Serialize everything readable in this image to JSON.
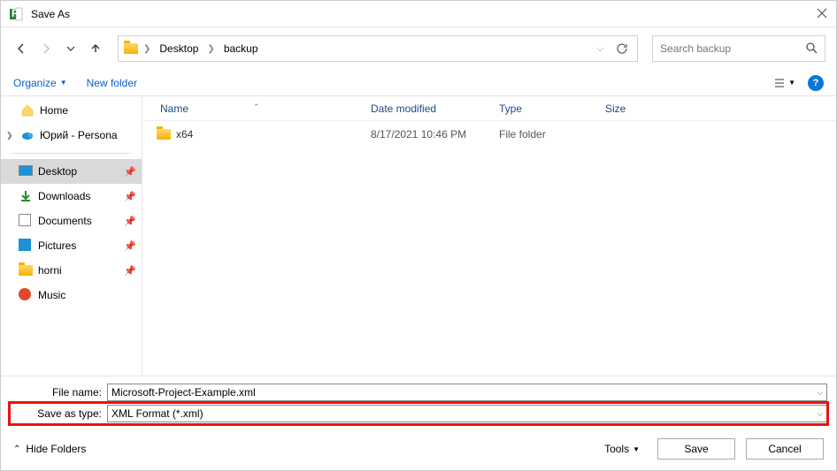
{
  "window": {
    "title": "Save As"
  },
  "breadcrumbs": [
    "Desktop",
    "backup"
  ],
  "search": {
    "placeholder": "Search backup"
  },
  "toolbar": {
    "organize": "Organize",
    "new_folder": "New folder"
  },
  "sidebar": {
    "top": [
      {
        "label": "Home"
      },
      {
        "label": "Юрий - Persona"
      }
    ],
    "quick": [
      {
        "label": "Desktop"
      },
      {
        "label": "Downloads"
      },
      {
        "label": "Documents"
      },
      {
        "label": "Pictures"
      },
      {
        "label": "horni"
      },
      {
        "label": "Music"
      }
    ]
  },
  "columns": {
    "name": "Name",
    "date": "Date modified",
    "type": "Type",
    "size": "Size"
  },
  "files": [
    {
      "name": "x64",
      "date": "8/17/2021 10:46 PM",
      "type": "File folder",
      "size": ""
    }
  ],
  "form": {
    "file_name_label": "File name:",
    "file_name_value": "Microsoft-Project-Example.xml",
    "save_type_label": "Save as type:",
    "save_type_value": "XML Format (*.xml)"
  },
  "footer": {
    "hide_folders": "Hide Folders",
    "tools": "Tools",
    "save": "Save",
    "cancel": "Cancel"
  }
}
